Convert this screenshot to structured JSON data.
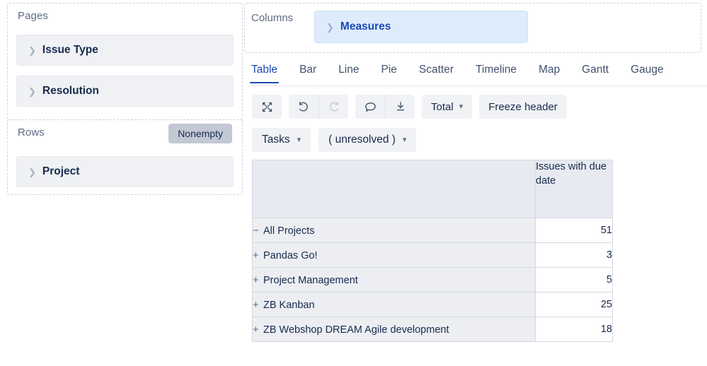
{
  "left_panel": {
    "pages": {
      "title": "Pages",
      "fields": [
        {
          "label": "Issue Type",
          "icon": "chevron-right-icon"
        },
        {
          "label": "Resolution",
          "icon": "chevron-right-icon"
        }
      ]
    },
    "rows": {
      "title": "Rows",
      "nonempty_label": "Nonempty",
      "fields": [
        {
          "label": "Project",
          "icon": "chevron-right-icon"
        }
      ]
    }
  },
  "columns_panel": {
    "title": "Columns",
    "fields": [
      {
        "label": "Measures",
        "icon": "chevron-right-icon",
        "color": "#1a49b8",
        "background": "#deebfb"
      }
    ]
  },
  "tabs": {
    "active": "Table",
    "items": [
      {
        "label": "Table"
      },
      {
        "label": "Bar"
      },
      {
        "label": "Line"
      },
      {
        "label": "Pie"
      },
      {
        "label": "Scatter"
      },
      {
        "label": "Timeline"
      },
      {
        "label": "Map"
      },
      {
        "label": "Gantt"
      },
      {
        "label": "Gauge"
      }
    ]
  },
  "toolbar": {
    "expand_icon": "expand-arrows-icon",
    "undo_icon": "undo-icon",
    "redo_icon": "redo-icon",
    "comment_icon": "comment-icon",
    "download_icon": "download-icon",
    "total_label": "Total",
    "total_caret": "chevron-down-icon",
    "freeze_header_label": "Freeze header"
  },
  "filters": [
    {
      "label": "Tasks",
      "caret": "chevron-down-icon"
    },
    {
      "label": "( unresolved )",
      "caret": "chevron-down-icon"
    }
  ],
  "table": {
    "corner_header": "",
    "measure_header": "Issues with due date",
    "rows": [
      {
        "toggle": "−",
        "label": "All Projects",
        "level": 0,
        "value": "51"
      },
      {
        "toggle": "+",
        "label": "Pandas Go!",
        "level": 1,
        "value": "3"
      },
      {
        "toggle": "+",
        "label": "Project Management",
        "level": 1,
        "value": "5"
      },
      {
        "toggle": "+",
        "label": "ZB Kanban",
        "level": 1,
        "value": "25"
      },
      {
        "toggle": "+",
        "label": "ZB Webshop DREAM Agile development",
        "level": 1,
        "value": "18"
      }
    ]
  },
  "colors": {
    "accent": "#1a49b8",
    "text": "#172b4d",
    "muted": "#5e6c84",
    "pill_bg": "#eff1f4",
    "header_bg": "#e7eaf0",
    "row_bg": "#eceef2"
  }
}
